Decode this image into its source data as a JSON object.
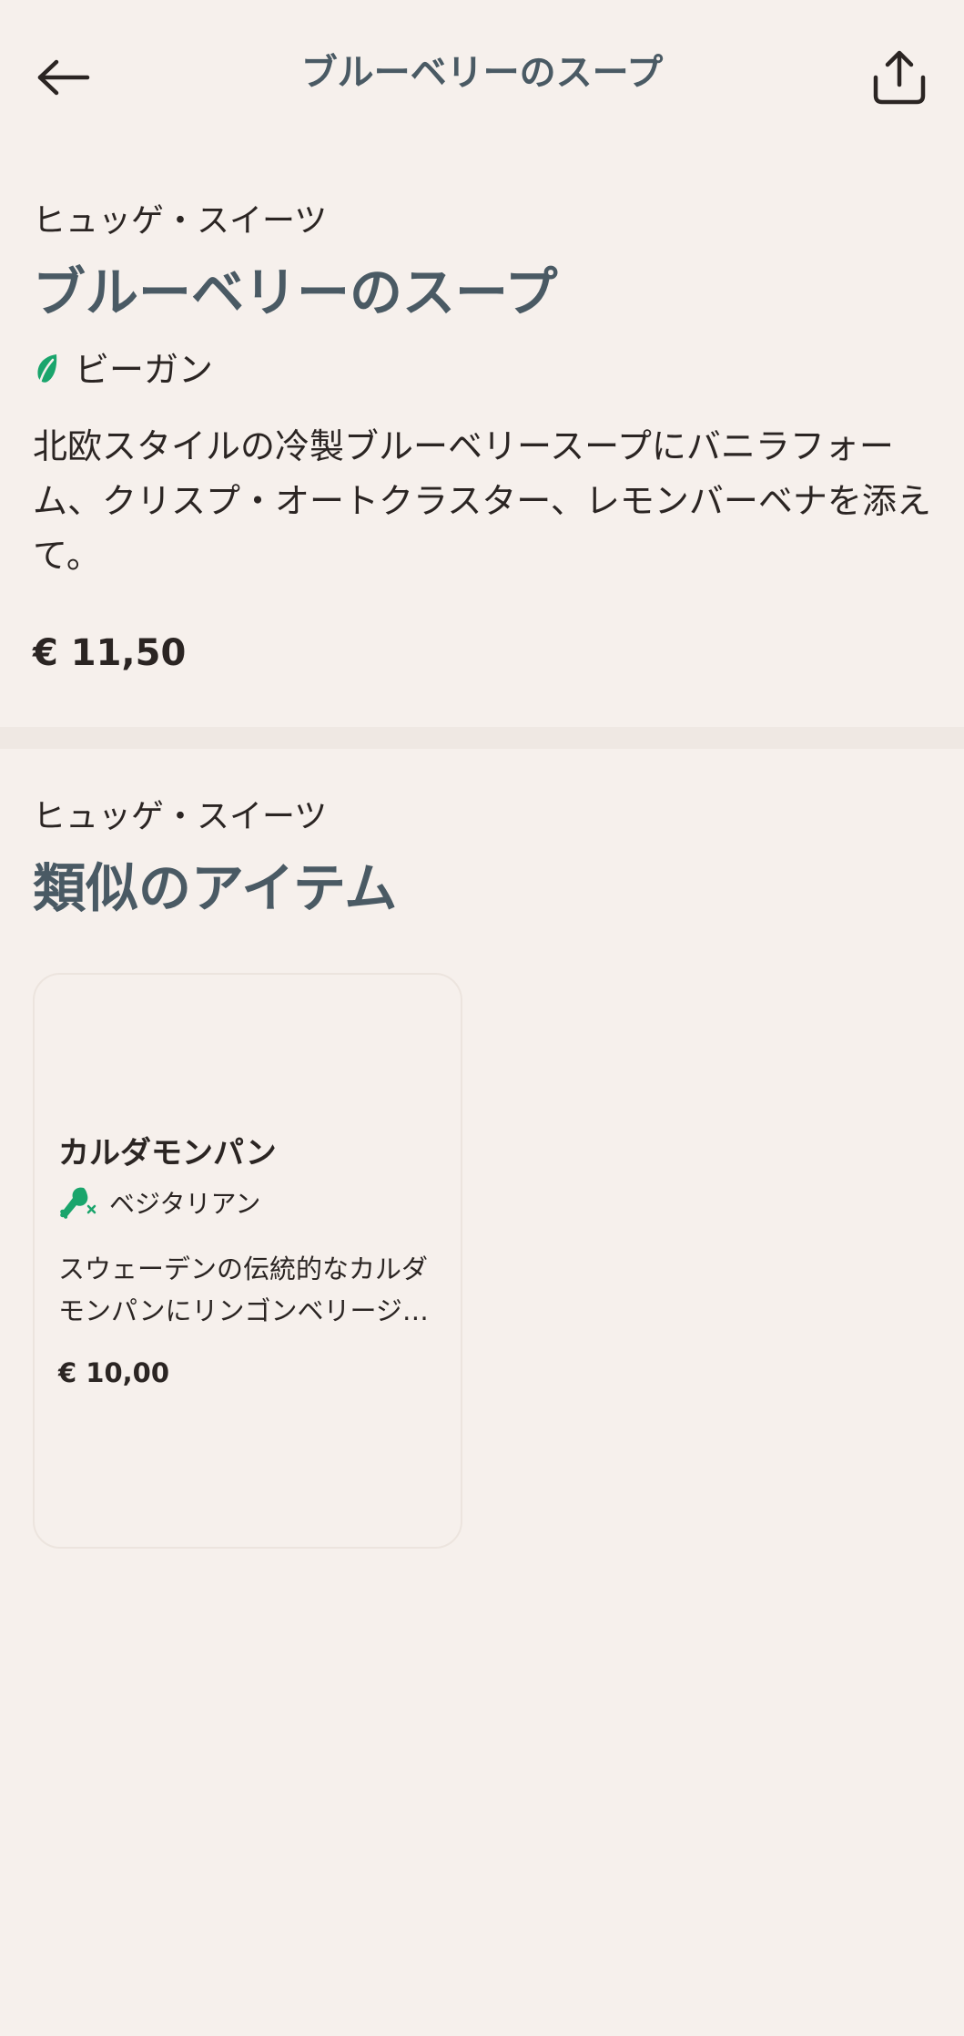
{
  "header": {
    "title": "ブルーベリーのスープ"
  },
  "item": {
    "category": "ヒュッゲ・スイーツ",
    "name": "ブルーベリーのスープ",
    "diet_label": "ビーガン",
    "description": "北欧スタイルの冷製ブルーベリースープにバニラフォーム、クリスプ・オートクラスター、レモンバーベナを添えて。",
    "price": "€ 11,50"
  },
  "similar": {
    "category": "ヒュッゲ・スイーツ",
    "heading": "類似のアイテム",
    "cards": [
      {
        "name": "カルダモンパン",
        "diet_label": "ベジタリアン",
        "description": "スウェーデンの伝統的なカルダモンパンにリンゴンベリージ…",
        "price": "€ 10,00"
      }
    ]
  },
  "colors": {
    "background": "#f6f0ec",
    "heading": "#4a5a64",
    "text": "#2b2523",
    "accent_green": "#1aa56c",
    "divider": "#efe8e3"
  },
  "icons": {
    "back": "arrow-left-icon",
    "share": "share-icon",
    "vegan": "leaf-icon",
    "vegetarian": "no-meat-icon"
  }
}
